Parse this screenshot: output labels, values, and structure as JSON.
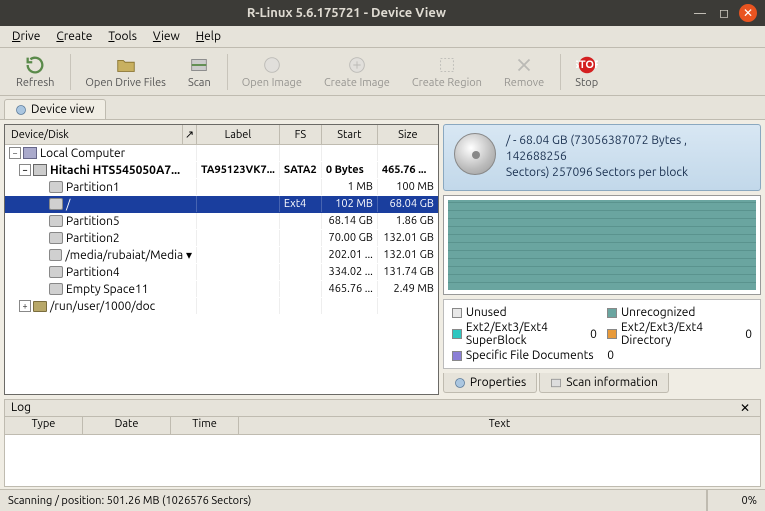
{
  "window": {
    "title": "R-Linux 5.6.175721 - Device View"
  },
  "menu": {
    "drive": "Drive",
    "create": "Create",
    "tools": "Tools",
    "view": "View",
    "help": "Help"
  },
  "toolbar": {
    "refresh": "Refresh",
    "open_drive_files": "Open Drive Files",
    "scan": "Scan",
    "open_image": "Open Image",
    "create_image": "Create Image",
    "create_region": "Create Region",
    "remove": "Remove",
    "stop": "Stop"
  },
  "tabs": {
    "device_view": "Device view"
  },
  "grid": {
    "headers": {
      "device": "Device/Disk",
      "label": "Label",
      "fs": "FS",
      "start": "Start",
      "size": "Size"
    }
  },
  "tree": {
    "root": "Local Computer",
    "drive": {
      "name": "Hitachi HTS545050A7...",
      "label": "TA95123VK7...",
      "fs": "SATA2",
      "start": "0 Bytes",
      "size": "465.76 ..."
    },
    "parts": [
      {
        "name": "Partition1",
        "label": "",
        "fs": "",
        "start": "1 MB",
        "size": "100 MB"
      },
      {
        "name": "/",
        "label": "",
        "fs": "Ext4",
        "start": "102 MB",
        "size": "68.04 GB",
        "selected": true
      },
      {
        "name": "Partition5",
        "label": "",
        "fs": "",
        "start": "68.14 GB",
        "size": "1.86 GB"
      },
      {
        "name": "Partition2",
        "label": "",
        "fs": "",
        "start": "70.00 GB",
        "size": "132.01 GB"
      },
      {
        "name": "/media/rubaiat/Media ▾",
        "label": "",
        "fs": "",
        "start": "202.01 ...",
        "size": "132.01 GB"
      },
      {
        "name": "Partition4",
        "label": "",
        "fs": "",
        "start": "334.02 ...",
        "size": "131.74 GB"
      },
      {
        "name": "Empty Space11",
        "label": "",
        "fs": "",
        "start": "465.76 ...",
        "size": "2.49 MB"
      }
    ],
    "doc_path": "/run/user/1000/doc"
  },
  "info": {
    "line1": "/ - 68.04 GB (73056387072 Bytes , 142688256",
    "line2": "Sectors) 257096 Sectors per block"
  },
  "legend": {
    "unused": "Unused",
    "unrecognized": "Unrecognized",
    "superblock": "Ext2/Ext3/Ext4 SuperBlock",
    "superblock_n": "0",
    "directory": "Ext2/Ext3/Ext4 Directory",
    "directory_n": "0",
    "docs": "Specific File Documents",
    "docs_n": "0"
  },
  "right_tabs": {
    "properties": "Properties",
    "scan_info": "Scan information"
  },
  "log": {
    "title": "Log",
    "headers": {
      "type": "Type",
      "date": "Date",
      "time": "Time",
      "text": "Text"
    }
  },
  "status": {
    "text": "Scanning / position: 501.26 MB (1026576 Sectors)",
    "percent": "0%"
  },
  "colors": {
    "unused": "#e8e8e8",
    "unrecognized": "#6aa5a0",
    "superblock": "#2fc6c0",
    "directory": "#e89a3a",
    "docs": "#8b7fd6"
  }
}
